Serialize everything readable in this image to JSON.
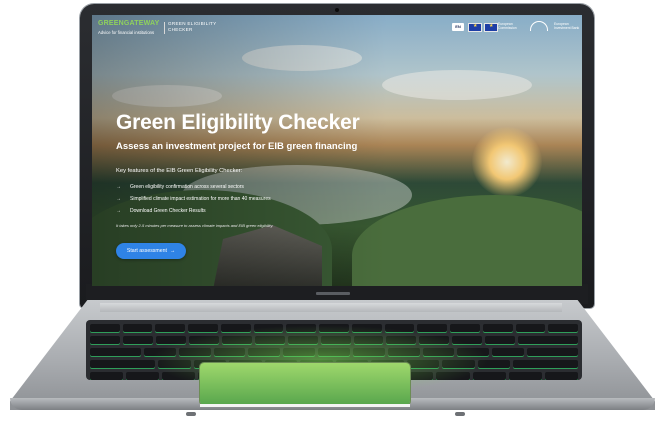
{
  "header": {
    "logo_main": "GREENGATEWAY",
    "logo_sub": "Advice for financial institutions",
    "app_name": "GREEN ELIGIBILITY CHECKER",
    "language": "EN",
    "partner_ec": "European Commission",
    "partner_eib": "European Investment Bank"
  },
  "hero": {
    "title": "Green Eligibility Checker",
    "subtitle": "Assess an investment project for EIB green financing",
    "features_heading": "Key features of the EIB Green Eligibility Checker:",
    "features": [
      "Green eligibility confirmation across several sectors",
      "Simplified climate impact estimation for more than 40 measures",
      "Download Green Checker Results"
    ],
    "note": "It takes only 2-5 minutes per measure to assess climate impacts and EIB green eligibility.",
    "cta_label": "Start assessment",
    "cta_icon": "arrow-right-icon",
    "feature_icon": "arrow-right-icon"
  },
  "colors": {
    "brand_green": "#8fd15d",
    "cta_blue": "#2f83e6",
    "eu_blue": "#1e3ea6"
  }
}
